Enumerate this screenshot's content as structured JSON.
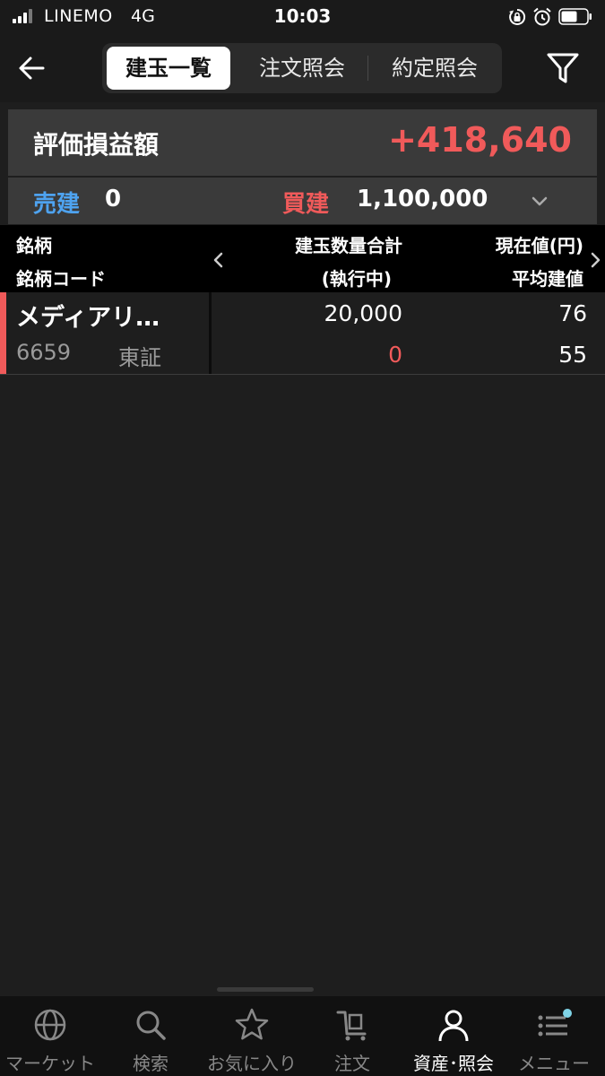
{
  "status_bar": {
    "carrier": "LINEMO",
    "network": "4G",
    "time": "10:03"
  },
  "nav": {
    "tabs": [
      {
        "label": "建玉一覧",
        "active": true
      },
      {
        "label": "注文照会",
        "active": false
      },
      {
        "label": "約定照会",
        "active": false
      }
    ]
  },
  "summary": {
    "pnl_label": "評価損益額",
    "pnl_value": "+418,640",
    "sell_label": "売建",
    "sell_value": "0",
    "buy_label": "買建",
    "buy_value": "1,100,000"
  },
  "table": {
    "headers": {
      "name": "銘柄",
      "code": "銘柄コード",
      "qty": "建玉数量合計",
      "exec": "(執行中)",
      "price": "現在値(円)",
      "avg": "平均建値"
    },
    "rows": [
      {
        "name": "メディアリ…",
        "code": "6659",
        "market": "東証",
        "qty": "20,000",
        "exec": "0",
        "price": "76",
        "avg": "55"
      }
    ]
  },
  "tab_bar": {
    "items": [
      {
        "label": "マーケット",
        "icon": "globe-icon"
      },
      {
        "label": "検索",
        "icon": "search-icon"
      },
      {
        "label": "お気に入り",
        "icon": "star-icon"
      },
      {
        "label": "注文",
        "icon": "cart-icon"
      },
      {
        "label": "資産･照会",
        "icon": "person-icon",
        "active": true
      },
      {
        "label": "メニュー",
        "icon": "menu-icon",
        "badge": true
      }
    ]
  },
  "colors": {
    "positive": "#f05a5a",
    "sell": "#4ea3f0",
    "background": "#1e1e1e",
    "panel": "#3a3a3a",
    "badge": "#7fd3e6"
  }
}
